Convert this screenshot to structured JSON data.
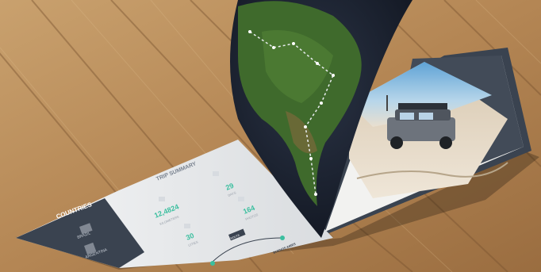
{
  "book": {
    "left_panel": {
      "heading": "COUNTRIES",
      "countries": [
        "BRAZIL",
        "ARGENTINA"
      ]
    },
    "summary": {
      "title": "TRIP SUMMARY",
      "stats": [
        {
          "value": "12,4824",
          "label": "KILOMETERS"
        },
        {
          "value": "29",
          "label": "DAYS"
        },
        {
          "value": "30",
          "label": "CITIES"
        },
        {
          "value": "164",
          "label": "PHOTOS"
        }
      ],
      "route_badge": "ROUTE",
      "route_end": "BUENOS AIRES"
    }
  },
  "colors": {
    "wood": "#b98e5c",
    "panel": "#3a4350",
    "accent": "#3bbf9f",
    "ocean": "#1d2330",
    "land": "#3f6a2c"
  }
}
